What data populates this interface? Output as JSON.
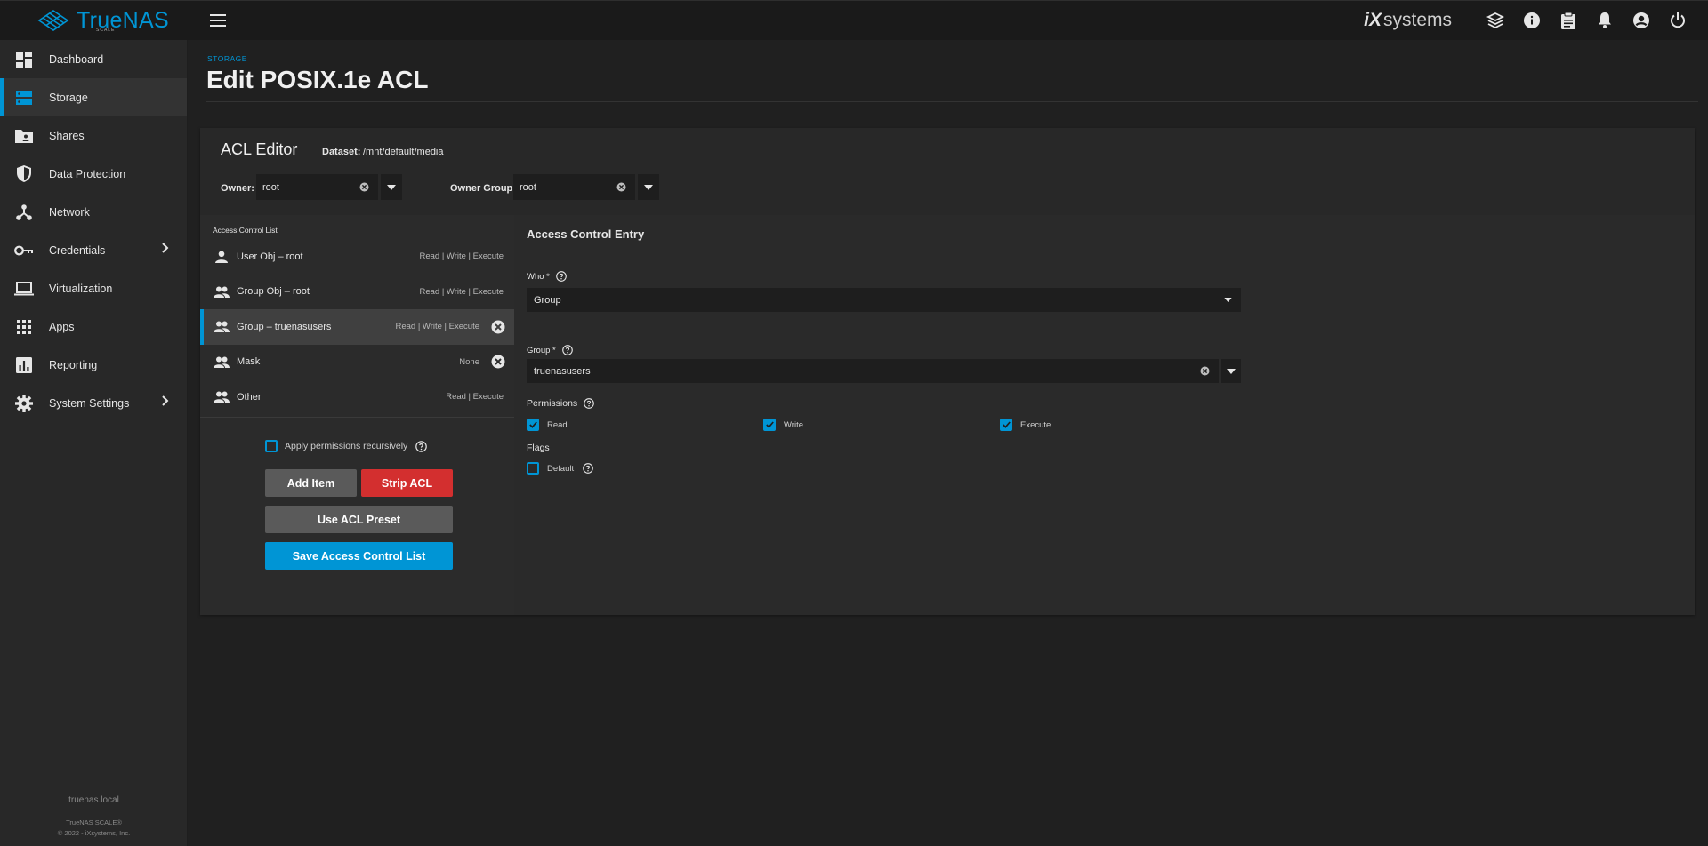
{
  "brand": {
    "name": "TrueNAS",
    "sub": "SCALE",
    "partner": "systems",
    "partner_prefix": "iX"
  },
  "colors": {
    "accent": "#0095d5",
    "danger": "#d32f2f",
    "background": "#202020",
    "sidebar": "#282828"
  },
  "sidebar": {
    "items": [
      {
        "label": "Dashboard",
        "icon": "dashboard-icon",
        "active": false
      },
      {
        "label": "Storage",
        "icon": "storage-icon",
        "active": true
      },
      {
        "label": "Shares",
        "icon": "shares-icon",
        "active": false
      },
      {
        "label": "Data Protection",
        "icon": "shield-icon",
        "active": false
      },
      {
        "label": "Network",
        "icon": "network-icon",
        "active": false
      },
      {
        "label": "Credentials",
        "icon": "key-icon",
        "active": false,
        "expandable": true
      },
      {
        "label": "Virtualization",
        "icon": "laptop-icon",
        "active": false
      },
      {
        "label": "Apps",
        "icon": "apps-grid-icon",
        "active": false
      },
      {
        "label": "Reporting",
        "icon": "reporting-icon",
        "active": false
      },
      {
        "label": "System Settings",
        "icon": "gear-icon",
        "active": false,
        "expandable": true
      }
    ],
    "footer": {
      "hostname": "truenas.local",
      "product": "TrueNAS SCALE®",
      "copyright": "© 2022 - iXsystems, Inc."
    }
  },
  "header": {
    "icons": [
      "truecommand-icon",
      "info-icon",
      "clipboard-icon",
      "bell-icon",
      "account-icon",
      "power-icon"
    ]
  },
  "page": {
    "breadcrumb": "STORAGE",
    "title": "Edit POSIX.1e ACL"
  },
  "editor": {
    "title": "ACL Editor",
    "dataset_label": "Dataset:",
    "dataset_value": "/mnt/default/media",
    "owner_label": "Owner:",
    "owner_value": "root",
    "owner_group_label": "Owner Group:",
    "owner_group_value": "root"
  },
  "acl": {
    "header": "Access Control List",
    "entries": [
      {
        "name": "User Obj – root",
        "perms": "Read | Write | Execute",
        "icon": "person-icon",
        "selected": false,
        "deletable": false
      },
      {
        "name": "Group Obj – root",
        "perms": "Read | Write | Execute",
        "icon": "group-icon",
        "selected": false,
        "deletable": false
      },
      {
        "name": "Group – truenasusers",
        "perms": "Read | Write | Execute",
        "icon": "group-icon",
        "selected": true,
        "deletable": true
      },
      {
        "name": "Mask",
        "perms": "None",
        "icon": "group-icon",
        "selected": false,
        "deletable": true
      },
      {
        "name": "Other",
        "perms": "Read | Execute",
        "icon": "group-icon",
        "selected": false,
        "deletable": false
      }
    ],
    "apply_recursively_label": "Apply permissions recursively",
    "apply_recursively": false,
    "buttons": {
      "add_item": "Add Item",
      "strip_acl": "Strip ACL",
      "use_preset": "Use ACL Preset",
      "save": "Save Access Control List"
    }
  },
  "ace": {
    "title": "Access Control Entry",
    "who_label": "Who *",
    "who_value": "Group",
    "group_label": "Group *",
    "group_value": "truenasusers",
    "permissions_label": "Permissions",
    "permissions": [
      {
        "label": "Read",
        "checked": true
      },
      {
        "label": "Write",
        "checked": true
      },
      {
        "label": "Execute",
        "checked": true
      }
    ],
    "flags_label": "Flags",
    "flags": [
      {
        "label": "Default",
        "checked": false
      }
    ]
  }
}
